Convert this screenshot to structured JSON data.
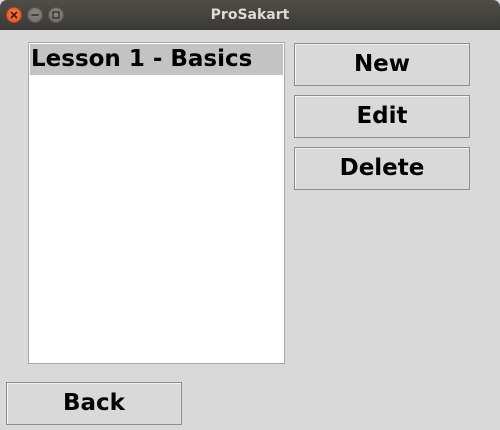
{
  "window": {
    "title": "ProSakart"
  },
  "lessons": {
    "items": [
      {
        "label": "Lesson 1 - Basics",
        "selected": true
      }
    ]
  },
  "actions": {
    "new_label": "New",
    "edit_label": "Edit",
    "delete_label": "Delete",
    "back_label": "Back"
  },
  "colors": {
    "titlebar": "#3b3a36",
    "window_bg": "#d9d9d9",
    "selection_bg": "#c3c3c3",
    "close_button": "#e0531f"
  }
}
